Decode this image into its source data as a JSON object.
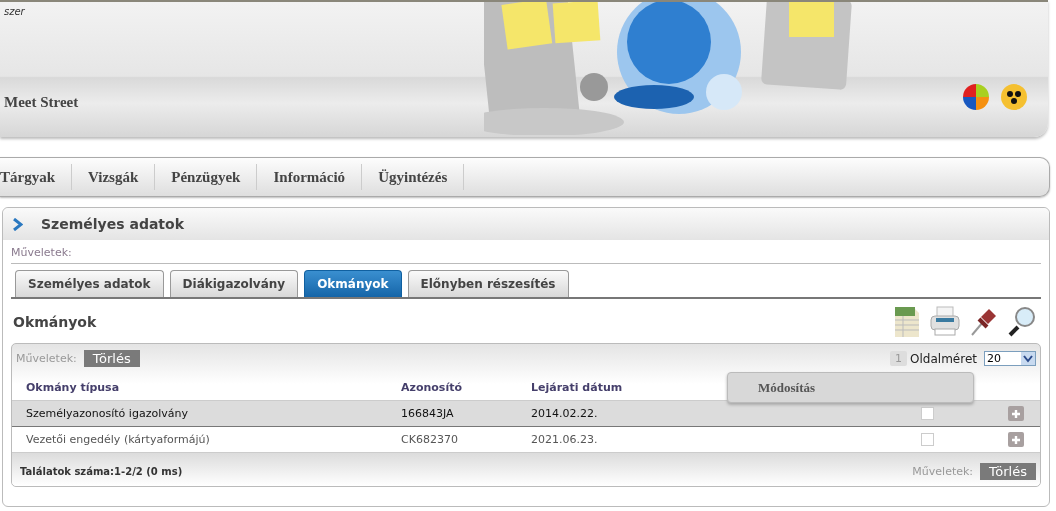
{
  "header": {
    "logo_caption": "szer",
    "user_name": "Meet Street"
  },
  "menu": [
    {
      "label": "Tárgyak"
    },
    {
      "label": "Vizsgák"
    },
    {
      "label": "Pénzügyek"
    },
    {
      "label": "Információ"
    },
    {
      "label": "Ügyintézés"
    }
  ],
  "panel": {
    "title": "Személyes adatok",
    "actions_label": "Műveletek:",
    "tabs": [
      {
        "label": "Személyes adatok",
        "selected": false
      },
      {
        "label": "Diákigazolvány",
        "selected": false
      },
      {
        "label": "Okmányok",
        "selected": true
      },
      {
        "label": "Előnyben részesítés",
        "selected": false
      }
    ],
    "section_title": "Okmányok",
    "grid": {
      "actions_label": "Műveletek:",
      "delete_button": "Törlés",
      "page_number": "1",
      "page_size_label": "Oldalméret",
      "page_size": "20",
      "columns": [
        "Okmány típusa",
        "Azonosító",
        "Lejárati dátum"
      ],
      "rows": [
        {
          "type": "Személyazonosító igazolvány",
          "id": "166843JA",
          "expiry": "2014.02.22.",
          "selected": true,
          "checked": false
        },
        {
          "type": "Vezetői engedély (kártyaformájú)",
          "id": "CK682370",
          "expiry": "2021.06.23.",
          "selected": false,
          "checked": false
        }
      ],
      "footer_count": "Találatok száma:1-2/2 (0 ms)",
      "footer_actions_label": "Műveletek:",
      "footer_delete_button": "Törlés"
    },
    "popup": {
      "label": "Módosítás"
    }
  }
}
